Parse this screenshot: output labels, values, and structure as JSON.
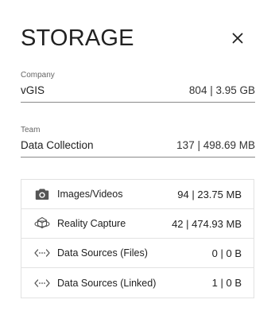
{
  "title": "STORAGE",
  "company": {
    "label": "Company",
    "name": "vGIS",
    "value": "804 | 3.95 GB"
  },
  "team": {
    "label": "Team",
    "name": "Data Collection",
    "value": "137 | 498.69 MB"
  },
  "breakdown": [
    {
      "icon": "camera-icon",
      "label": "Images/Videos",
      "value": "94 | 23.75 MB"
    },
    {
      "icon": "reality-capture-icon",
      "label": "Reality Capture",
      "value": "42 | 474.93 MB"
    },
    {
      "icon": "code-arrows-icon",
      "label": "Data Sources (Files)",
      "value": "0 | 0 B"
    },
    {
      "icon": "code-arrows-icon",
      "label": "Data Sources (Linked)",
      "value": "1 | 0 B"
    }
  ]
}
